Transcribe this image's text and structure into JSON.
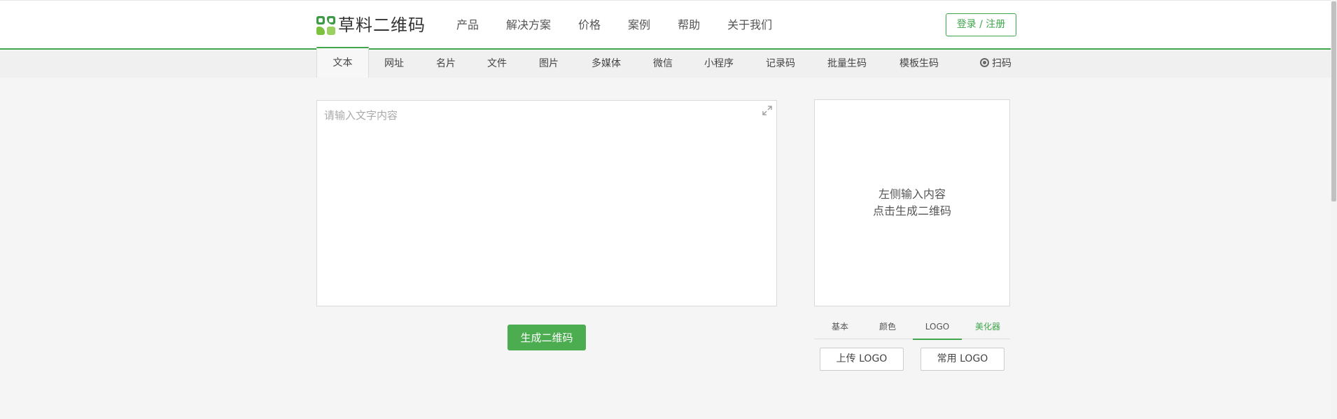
{
  "brand": {
    "name": "草料二维码",
    "accent_color": "#3fa64b"
  },
  "header": {
    "nav": [
      "产品",
      "解决方案",
      "价格",
      "案例",
      "帮助",
      "关于我们"
    ],
    "login_label": "登录 / 注册"
  },
  "tabs": {
    "items": [
      "文本",
      "网址",
      "名片",
      "文件",
      "图片",
      "多媒体",
      "微信",
      "小程序",
      "记录码",
      "批量生码",
      "模板生码"
    ],
    "active": "文本",
    "scan_label": "扫码",
    "scan_icon": "camera-icon"
  },
  "editor": {
    "placeholder": "请输入文字内容",
    "value": "",
    "expand_icon": "expand-icon"
  },
  "generate_label": "生成二维码",
  "preview": {
    "line1": "左侧输入内容",
    "line2": "点击生成二维码"
  },
  "style_tabs": {
    "items": [
      "基本",
      "颜色",
      "LOGO",
      "美化器"
    ],
    "active": "LOGO"
  },
  "logo_buttons": {
    "upload": "上传 LOGO",
    "common": "常用 LOGO"
  }
}
